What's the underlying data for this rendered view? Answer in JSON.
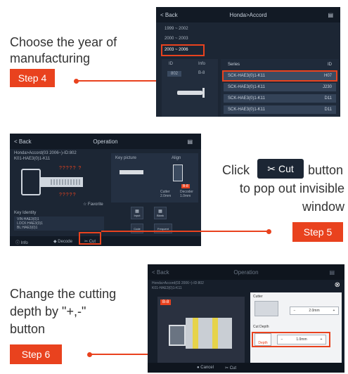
{
  "captions": {
    "step4_text": [
      "Choose the year of",
      "manufacturing"
    ],
    "step5_click": "Click",
    "step5_rest": [
      "button",
      "to pop out invisible",
      "window"
    ],
    "step6_text": [
      "Change the cutting",
      "depth by \"+,-\"",
      "button"
    ]
  },
  "steps": {
    "step4": "Step 4",
    "step5": "Step 5",
    "step6": "Step 6"
  },
  "cut_button": {
    "label": "Cut",
    "icon": "scissors-icon"
  },
  "shot1": {
    "back": "< Back",
    "title": "Honda>Accord",
    "years": [
      "1999 ~ 2002",
      "2000 ~ 2003",
      "2003 ~ 2006"
    ],
    "table_headers": [
      "ID",
      "Info"
    ],
    "id_cell": "802",
    "info_cell": "B-8",
    "series_header": [
      "Series",
      "ID"
    ],
    "series_rows": [
      [
        "SCK-HAE3(0)1-K11",
        "H07"
      ],
      [
        "SCK-HAE3(0)1-K11",
        "J230"
      ],
      [
        "SCK-HAE3(0)1-K11",
        "D11"
      ],
      [
        "SCK-HAE3(0)1-K11",
        "D11"
      ]
    ]
  },
  "shot2": {
    "back": "< Back",
    "title": "Operation",
    "key_info": [
      "Honda>Accord(03 2006~)-ID:802",
      "K01-HAE3(0)1-K11"
    ],
    "favorite": "Favorite",
    "key_picture": "Key picture",
    "align": "Align",
    "cutter_label": "Cutter",
    "cutter_value": "2.0mm",
    "decoder_label": "Decoder",
    "decoder_value": "1.0mm",
    "key_identity": "Key Identity",
    "identity_lines": [
      "VIN:HAE3(0)1",
      "LOCK:HAE3(0)1",
      "BL:HAE3(0)1"
    ],
    "tools": [
      "Input",
      "Blank",
      "Code",
      "Frequent"
    ],
    "bottom": [
      "Info",
      "Decode",
      "Cut"
    ]
  },
  "shot3": {
    "back": "< Back",
    "title": "Operation",
    "key_info": [
      "Honda>Accord(03 2006~)-ID:802",
      "K01-HAE3(0)1-K11"
    ],
    "tag": "B-8",
    "cutter_label": "Cutter",
    "cutter_value": "2.0mm",
    "depth_label": "Cut Depth",
    "depth_value": "1.0mm",
    "depth_tag": "Depth",
    "bottom": [
      "Cancel",
      "Cut"
    ]
  },
  "colors": {
    "accent": "#e9421e",
    "panel": "#1c2634"
  }
}
